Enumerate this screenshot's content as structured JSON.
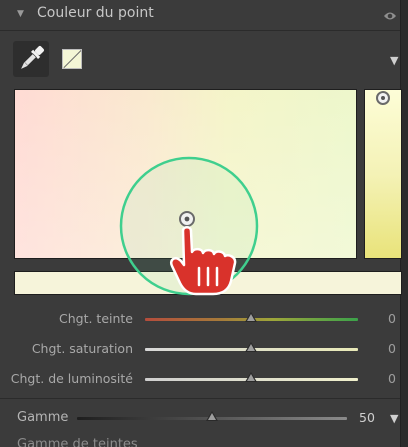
{
  "panel": {
    "title": "Couleur du point",
    "visibility_icon": "eye-icon",
    "collapse_icon": "triangle-down-icon"
  },
  "tools": {
    "eyedropper_icon": "eyedropper-icon",
    "swatch_color": "#f4f6d6",
    "menu_arrow": "▼"
  },
  "colors": {
    "field_left": "#ffd9d2",
    "field_right": "#ecf7c9",
    "strip_top": "#fdfdd7",
    "strip_bottom": "#e9e37a",
    "preview": "#f6f4da",
    "picker_ring": "#3fcf8e",
    "hand_cursor": "#d9322b"
  },
  "sliders": [
    {
      "label": "Chgt. teinte",
      "value": "0",
      "position": 0.5,
      "track": "hue"
    },
    {
      "label": "Chgt. saturation",
      "value": "0",
      "position": 0.5,
      "track": "sat"
    },
    {
      "label": "Chgt. de luminosité",
      "value": "0",
      "position": 0.5,
      "track": "lum"
    }
  ],
  "gamme": {
    "label": "Gamme",
    "value": "50",
    "position": 0.5,
    "arrow": "▼"
  },
  "cut_off_label": "Gamme de teintes"
}
